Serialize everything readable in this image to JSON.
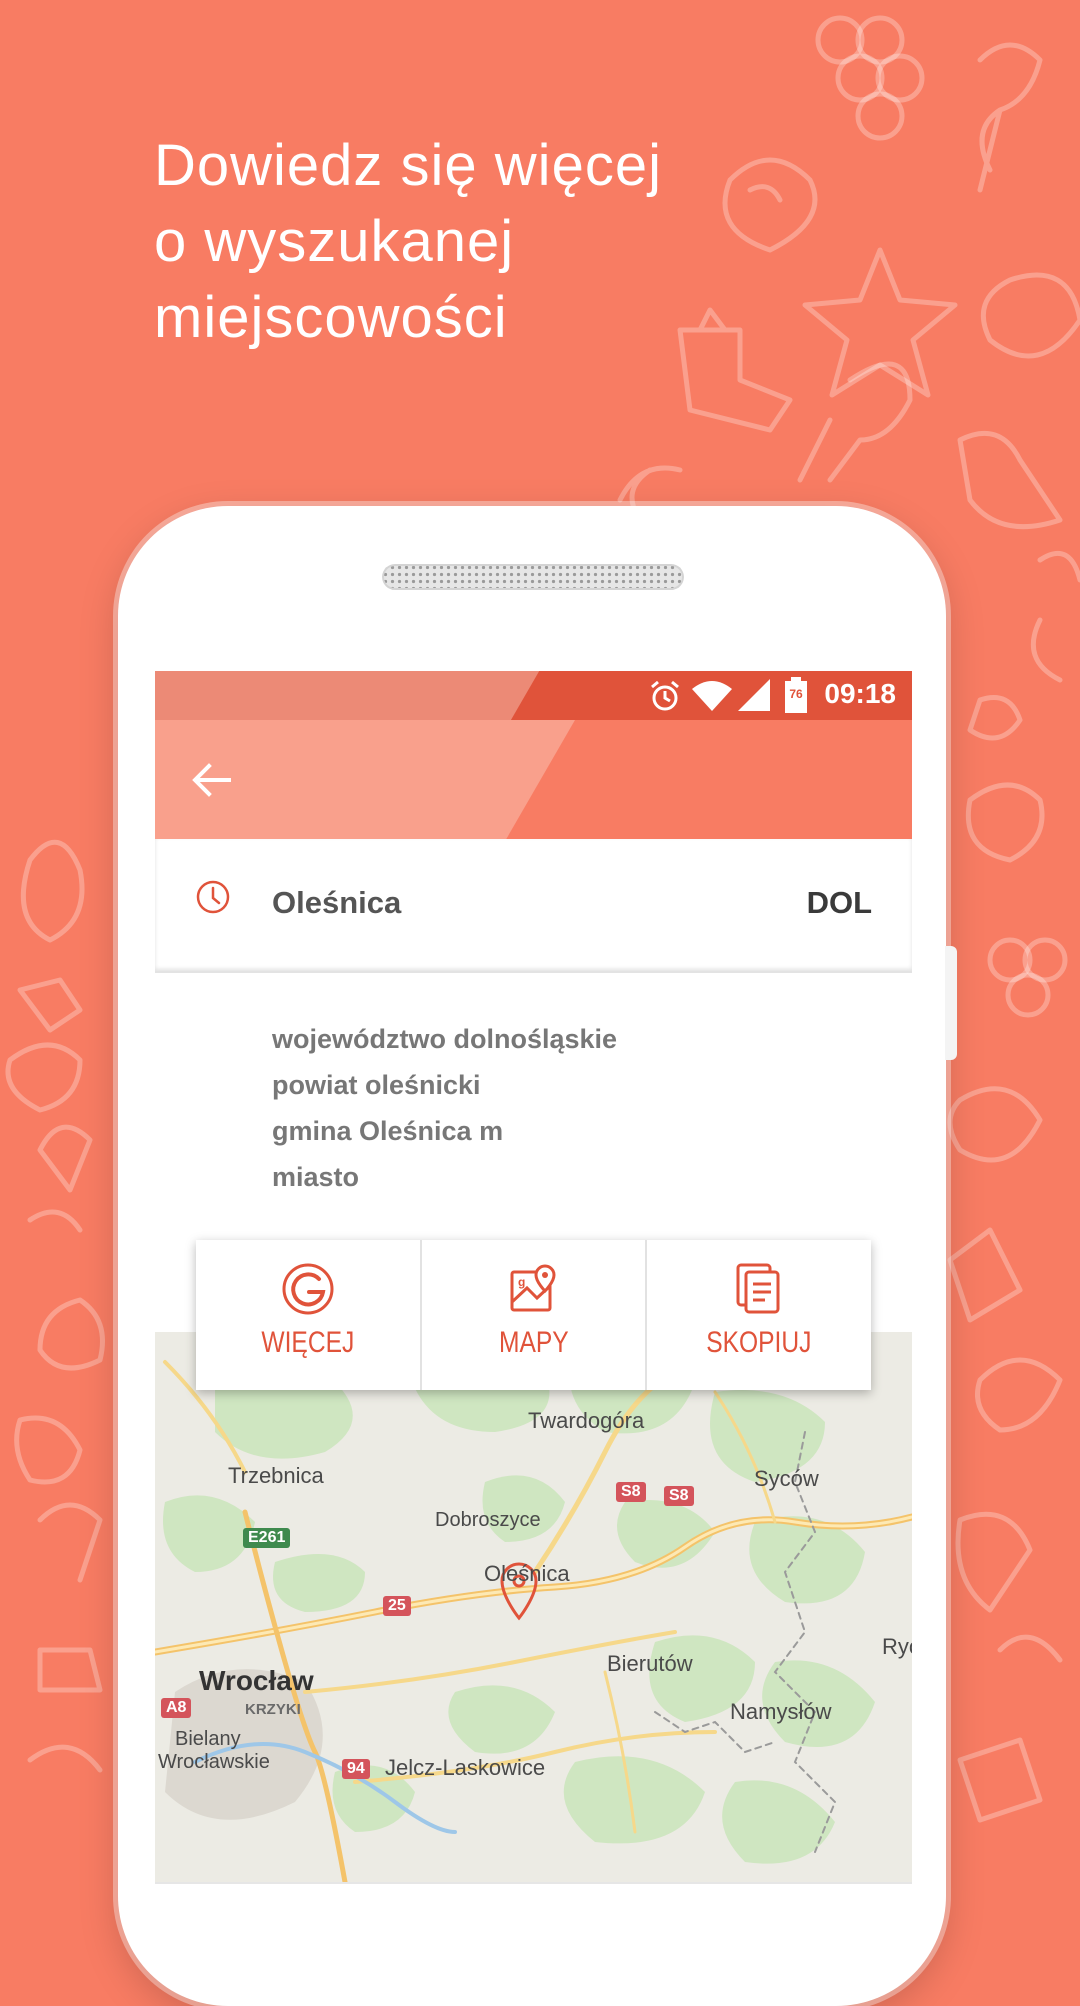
{
  "promo": {
    "headline_lines": [
      "Dowiedz się więcej",
      "o wyszukanej",
      "miejscowości"
    ]
  },
  "status_bar": {
    "time": "09:18",
    "battery_level": "76",
    "icons": [
      "alarm-icon",
      "wifi-icon",
      "cell-signal-icon",
      "battery-icon"
    ]
  },
  "toolbar": {
    "back_icon": "arrow-back-icon"
  },
  "result": {
    "icon": "history-clock-icon",
    "city": "Oleśnica",
    "code": "DOL",
    "details": [
      "województwo dolnośląskie",
      "powiat oleśnicki",
      "gmina Oleśnica m",
      "miasto"
    ]
  },
  "actions": [
    {
      "label": "WIĘCEJ",
      "icon": "google-icon"
    },
    {
      "label": "MAPY",
      "icon": "map-pin-icon"
    },
    {
      "label": "SKOPIUJ",
      "icon": "copy-icon"
    }
  ],
  "map": {
    "places": [
      "Twardogóra",
      "Trzebnica",
      "Syców",
      "Dobroszyce",
      "Oleśnica",
      "Bierutów",
      "Rychta",
      "Wrocław",
      "KRZYKI",
      "Namysłów",
      "Bielany",
      "Wrocławskie",
      "Jelcz-Laskowice"
    ],
    "roads": [
      "E261",
      "S8",
      "25",
      "S8",
      "A8",
      "94"
    ]
  },
  "colors": {
    "background": "#f87c63",
    "accent": "#e0533a",
    "toolbar": "#f87c63"
  }
}
